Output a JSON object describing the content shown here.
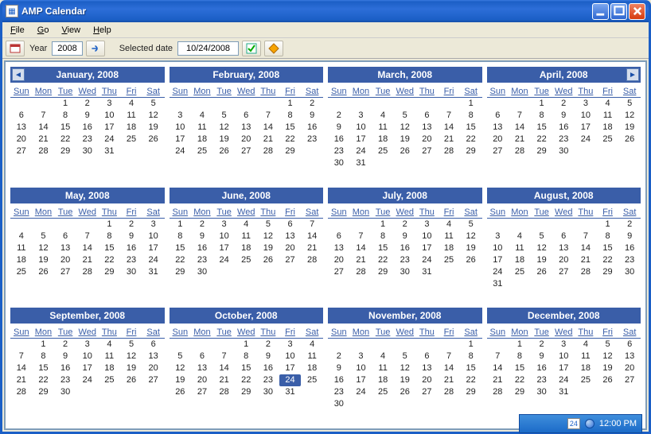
{
  "window": {
    "title": "AMP Calendar"
  },
  "menu": {
    "file": "File",
    "go": "Go",
    "view": "View",
    "help": "Help"
  },
  "toolbar": {
    "year_label": "Year",
    "year_value": "2008",
    "selected_label": "Selected date",
    "selected_value": "10/24/2008"
  },
  "calendar": {
    "dow": [
      "Sun",
      "Mon",
      "Tue",
      "Wed",
      "Thu",
      "Fri",
      "Sat"
    ],
    "selected": {
      "month": 10,
      "day": 24
    },
    "months": [
      {
        "title": "January, 2008",
        "start": 2,
        "days": 31,
        "nav": "prev"
      },
      {
        "title": "February, 2008",
        "start": 5,
        "days": 29
      },
      {
        "title": "March, 2008",
        "start": 6,
        "days": 31
      },
      {
        "title": "April, 2008",
        "start": 2,
        "days": 30,
        "nav": "next"
      },
      {
        "title": "May, 2008",
        "start": 4,
        "days": 31
      },
      {
        "title": "June, 2008",
        "start": 0,
        "days": 30
      },
      {
        "title": "July, 2008",
        "start": 2,
        "days": 31
      },
      {
        "title": "August, 2008",
        "start": 5,
        "days": 31
      },
      {
        "title": "September, 2008",
        "start": 1,
        "days": 30
      },
      {
        "title": "October, 2008",
        "start": 3,
        "days": 31
      },
      {
        "title": "November, 2008",
        "start": 6,
        "days": 30
      },
      {
        "title": "December, 2008",
        "start": 1,
        "days": 31
      }
    ]
  },
  "tray": {
    "day": "24",
    "time": "12:00 PM"
  }
}
